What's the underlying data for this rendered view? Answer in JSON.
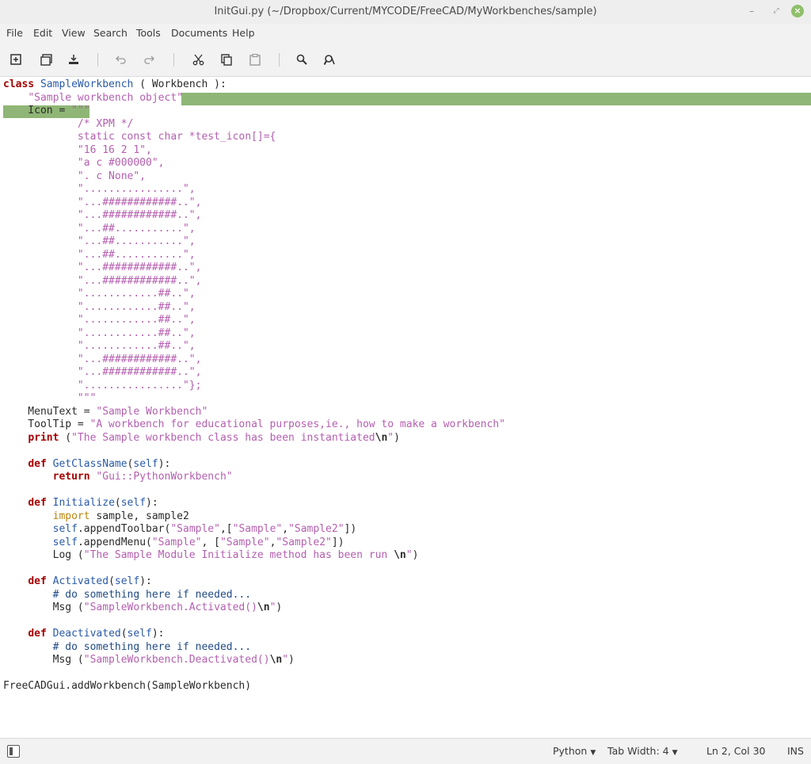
{
  "window": {
    "title": "InitGui.py (~/Dropbox/Current/MYCODE/FreeCAD/MyWorkbenches/sample)"
  },
  "menubar": {
    "items": [
      "File",
      "Edit",
      "View",
      "Search",
      "Tools",
      "Documents",
      "Help"
    ]
  },
  "toolbar": {
    "icons": [
      "new-document-icon",
      "open-document-icon",
      "save-icon",
      "undo-icon",
      "redo-icon",
      "cut-icon",
      "copy-icon",
      "paste-icon",
      "search-icon",
      "replace-icon"
    ]
  },
  "editor": {
    "highlight_color": "#8fb676",
    "lines": [
      "class SampleWorkbench ( Workbench ):",
      "    \"Sample workbench object\"",
      "    Icon = \"\"\"",
      "            /* XPM */",
      "            static const char *test_icon[]={",
      "            \"16 16 2 1\",",
      "            \"a c #000000\",",
      "            \". c None\",",
      "            \"................\",",
      "            \"...############..\",",
      "            \"...############..\",",
      "            \"...##...........\",",
      "            \"...##...........\",",
      "            \"...##...........\",",
      "            \"...############..\",",
      "            \"...############..\",",
      "            \"............##..\",",
      "            \"............##..\",",
      "            \"............##..\",",
      "            \"............##..\",",
      "            \"............##..\",",
      "            \"...############..\",",
      "            \"...############..\",",
      "            \"................\"};",
      "            \"\"\"",
      "    MenuText = \"Sample Workbench\"",
      "    ToolTip = \"A workbench for educational purposes,ie., how to make a workbench\"",
      "    print (\"The Sample workbench class has been instantiated\\n\")",
      "",
      "    def GetClassName(self):",
      "        return \"Gui::PythonWorkbench\"",
      "",
      "    def Initialize(self):",
      "        import sample, sample2",
      "        self.appendToolbar(\"Sample\",[\"Sample\",\"Sample2\"])",
      "        self.appendMenu(\"Sample\", [\"Sample\",\"Sample2\"])",
      "        Log (\"The Sample Module Initialize method has been run \\n\")",
      "",
      "    def Activated(self):",
      "        # do something here if needed...",
      "        Msg (\"SampleWorkbench.Activated()\\n\")",
      "",
      "    def Deactivated(self):",
      "        # do something here if needed...",
      "        Msg (\"SampleWorkbench.Deactivated()\\n\")",
      "",
      "FreeCADGui.addWorkbench(SampleWorkbench)"
    ]
  },
  "statusbar": {
    "language": "Python",
    "tab_width": "Tab Width: 4",
    "cursor_position": "Ln 2, Col 30",
    "insert_mode": "INS"
  }
}
